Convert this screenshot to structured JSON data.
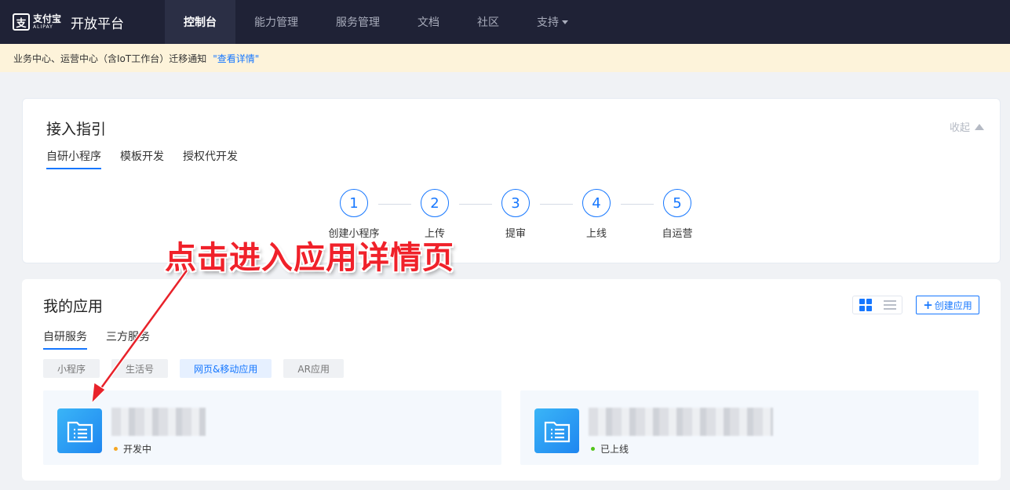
{
  "brand": {
    "logo_cn": "支付宝",
    "logo_en": "ALIPAY",
    "platform": "开放平台"
  },
  "nav": {
    "items": [
      {
        "label": "控制台",
        "active": true
      },
      {
        "label": "能力管理",
        "active": false
      },
      {
        "label": "服务管理",
        "active": false
      },
      {
        "label": "文档",
        "active": false
      },
      {
        "label": "社区",
        "active": false
      },
      {
        "label": "支持",
        "active": false
      }
    ]
  },
  "notice": {
    "text": "业务中心、运营中心（含IoT工作台）迁移通知",
    "link": "\"查看详情\""
  },
  "guide": {
    "title": "接入指引",
    "collapse_label": "收起",
    "tabs": [
      "自研小程序",
      "模板开发",
      "授权代开发"
    ],
    "steps": [
      {
        "num": "1",
        "label": "创建小程序"
      },
      {
        "num": "2",
        "label": "上传"
      },
      {
        "num": "3",
        "label": "提审"
      },
      {
        "num": "4",
        "label": "上线"
      },
      {
        "num": "5",
        "label": "自运营"
      }
    ]
  },
  "myapps": {
    "title": "我的应用",
    "create_label": "创建应用",
    "tabs": [
      "自研服务",
      "三方服务"
    ],
    "filters": [
      "小程序",
      "生活号",
      "网页&移动应用",
      "AR应用"
    ],
    "apps": [
      {
        "status": "开发中",
        "status_color": "#f5a623"
      },
      {
        "status": "已上线",
        "status_color": "#52c41a"
      }
    ]
  },
  "annotation": {
    "text": "点击进入应用详情页",
    "color": "#f0212a"
  }
}
